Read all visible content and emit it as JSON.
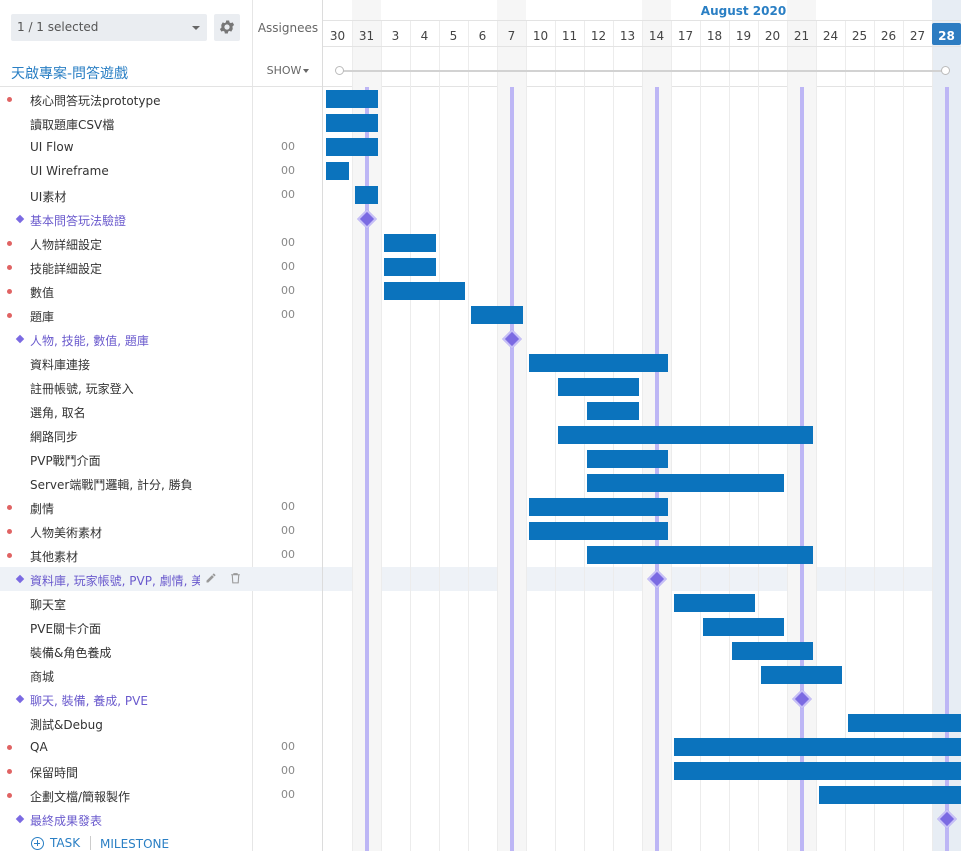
{
  "header": {
    "filter_label": "1 / 1 selected",
    "assignees_label": "Assignees",
    "show_label": "SHOW",
    "project_title": "天啟專案-問答遊戲"
  },
  "timeline": {
    "month": "August 2020",
    "days": [
      "30",
      "31",
      "3",
      "4",
      "5",
      "6",
      "7",
      "10",
      "11",
      "12",
      "13",
      "14",
      "17",
      "18",
      "19",
      "20",
      "21",
      "24",
      "25",
      "26",
      "27",
      "28"
    ],
    "today_index": 21,
    "weekend_indices": [
      1,
      6,
      11,
      16,
      21
    ]
  },
  "colors": {
    "bar": "#0b73bd",
    "milestone": "#7b6ae2",
    "accent": "#2a7fc4",
    "priority_dot": "#e06363"
  },
  "rows": [
    {
      "name": "核心問答玩法prototype",
      "type": "task",
      "assignee": "",
      "dot": true,
      "start": 0,
      "end": 1.8
    },
    {
      "name": "讀取題庫CSV檔",
      "type": "task",
      "assignee": "",
      "dot": false,
      "start": 0,
      "end": 1.8
    },
    {
      "name": "UI Flow",
      "type": "task",
      "assignee": "00",
      "dot": false,
      "start": 0,
      "end": 1.8
    },
    {
      "name": "UI Wireframe",
      "type": "task",
      "assignee": "00",
      "dot": false,
      "start": 0,
      "end": 0.8
    },
    {
      "name": "UI素材",
      "type": "task",
      "assignee": "00",
      "dot": false,
      "start": 1,
      "end": 1.8
    },
    {
      "name": "基本問答玩法驗證",
      "type": "milestone",
      "at": 1
    },
    {
      "name": "人物詳細設定",
      "type": "task",
      "assignee": "00",
      "dot": true,
      "start": 2,
      "end": 3.8
    },
    {
      "name": "技能詳細設定",
      "type": "task",
      "assignee": "00",
      "dot": true,
      "start": 2,
      "end": 3.8
    },
    {
      "name": "數值",
      "type": "task",
      "assignee": "00",
      "dot": true,
      "start": 2,
      "end": 4.8
    },
    {
      "name": "題庫",
      "type": "task",
      "assignee": "00",
      "dot": true,
      "start": 5,
      "end": 6.8
    },
    {
      "name": "人物, 技能, 數值, 題庫",
      "type": "milestone",
      "at": 6
    },
    {
      "name": "資料庫連接",
      "type": "task",
      "assignee": "",
      "dot": false,
      "start": 7,
      "end": 11.8
    },
    {
      "name": "註冊帳號, 玩家登入",
      "type": "task",
      "assignee": "",
      "dot": false,
      "start": 8,
      "end": 10.8
    },
    {
      "name": "選角, 取名",
      "type": "task",
      "assignee": "",
      "dot": false,
      "start": 9,
      "end": 10.8
    },
    {
      "name": "網路同步",
      "type": "task",
      "assignee": "",
      "dot": false,
      "start": 8,
      "end": 16.8
    },
    {
      "name": "PVP戰鬥介面",
      "type": "task",
      "assignee": "",
      "dot": false,
      "start": 9,
      "end": 11.8
    },
    {
      "name": "Server端戰鬥邏輯, 計分, 勝負",
      "type": "task",
      "assignee": "",
      "dot": false,
      "start": 9,
      "end": 15.8
    },
    {
      "name": "劇情",
      "type": "task",
      "assignee": "00",
      "dot": true,
      "start": 7,
      "end": 11.8
    },
    {
      "name": "人物美術素材",
      "type": "task",
      "assignee": "00",
      "dot": true,
      "start": 7,
      "end": 11.8
    },
    {
      "name": "其他素材",
      "type": "task",
      "assignee": "00",
      "dot": true,
      "start": 9,
      "end": 16.8
    },
    {
      "name": "資料庫, 玩家帳號, PVP, 劇情, 美術",
      "type": "milestone",
      "at": 11,
      "highlight": true
    },
    {
      "name": "聊天室",
      "type": "task",
      "assignee": "",
      "dot": false,
      "start": 12,
      "end": 14.8
    },
    {
      "name": "PVE關卡介面",
      "type": "task",
      "assignee": "",
      "dot": false,
      "start": 13,
      "end": 15.8
    },
    {
      "name": "裝備&角色養成",
      "type": "task",
      "assignee": "",
      "dot": false,
      "start": 14,
      "end": 16.8
    },
    {
      "name": "商城",
      "type": "task",
      "assignee": "",
      "dot": false,
      "start": 15,
      "end": 17.8
    },
    {
      "name": "聊天, 裝備, 養成, PVE",
      "type": "milestone",
      "at": 16
    },
    {
      "name": "測試&Debug",
      "type": "task",
      "assignee": "",
      "dot": false,
      "start": 18,
      "end": 21.9
    },
    {
      "name": "QA",
      "type": "task",
      "assignee": "00",
      "dot": true,
      "start": 12,
      "end": 21.9
    },
    {
      "name": "保留時間",
      "type": "task",
      "assignee": "00",
      "dot": true,
      "start": 12,
      "end": 21.9
    },
    {
      "name": "企劃文檔/簡報製作",
      "type": "task",
      "assignee": "00",
      "dot": true,
      "start": 17,
      "end": 21.9
    },
    {
      "name": "最終成果發表",
      "type": "milestone",
      "at": 21
    }
  ],
  "footer": {
    "task_label": "TASK",
    "milestone_label": "MILESTONE"
  }
}
